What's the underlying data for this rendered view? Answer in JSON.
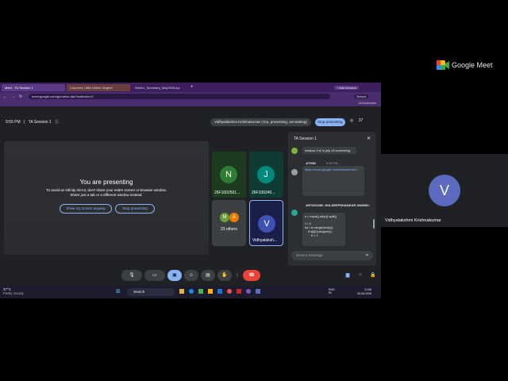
{
  "brand": {
    "name": "Google Meet"
  },
  "browser": {
    "tabs": [
      {
        "label": "Meet - TA Session 1",
        "active": true
      },
      {
        "label": "Coursera | IBM Online Degree",
        "active": false
      },
      {
        "label": "Week1_Summary_May2026.ipy",
        "active": false
      }
    ],
    "url": "meet.google.com/grd-desv-daz?authuser=0",
    "bookmarks": "All Bookmarks",
    "profile": "School"
  },
  "meeting": {
    "time": "9:55 PM",
    "title": "TA Session 1",
    "presenter_notice": "Vidhyalakshmi Krishnakumar (You, presenting, annotating)",
    "stop_presenting": "Stop presenting",
    "participant_count": "37"
  },
  "presenting": {
    "heading": "You are presenting",
    "line1": "To avoid an infinity mirror, don't share your entire screen or browser window.",
    "line2": "Share just a tab or a different window instead.",
    "show_button": "Show my screen anyway",
    "stop_button": "Stop presenting"
  },
  "tiles": [
    {
      "initial": "N",
      "name": "26F1002501...",
      "color": "#1b5e20"
    },
    {
      "initial": "J",
      "name": "26F100240...",
      "color": "#00695c"
    },
    {
      "initial": "",
      "name": "23 others",
      "color": "#3c4043"
    },
    {
      "initial": "V",
      "name": "Vidhyalaksh...",
      "color": "#3f51b5"
    }
  ],
  "others_avatars": [
    {
      "initial": "M",
      "color": "#689f38"
    },
    {
      "initial": "A",
      "color": "#e67c00"
    }
  ],
  "chat": {
    "title": "TA Session 1",
    "messages": [
      {
        "text": "window 3 is in july 16 something"
      },
      {
        "sender": "JITHIN",
        "time": "9:48 PM",
        "text": "https://docs.google.com/document/d/..."
      },
      {
        "sender": "26F1002280 JHA DEEPSHANKAR ANAND",
        "time": "9:48 PM",
        "text": "s = input().strip().split()"
      },
      {
        "text": "i = 0"
      },
      {
        "text": "for i in range(len(s)):"
      },
      {
        "text": "if s[i][0].isupper():"
      },
      {
        "text": "fl = 1"
      }
    ],
    "input_placeholder": "Send a message"
  },
  "taskbar": {
    "weather_temp": "27°C",
    "weather_desc": "Partly cloudy",
    "search": "Search",
    "lang": "ENG IN",
    "time": "21:55",
    "date": "30-06-2026"
  },
  "right_tile": {
    "initial": "V",
    "name": "Vidhyalakshmi Krishnakumar",
    "color": "#3f51b5"
  }
}
